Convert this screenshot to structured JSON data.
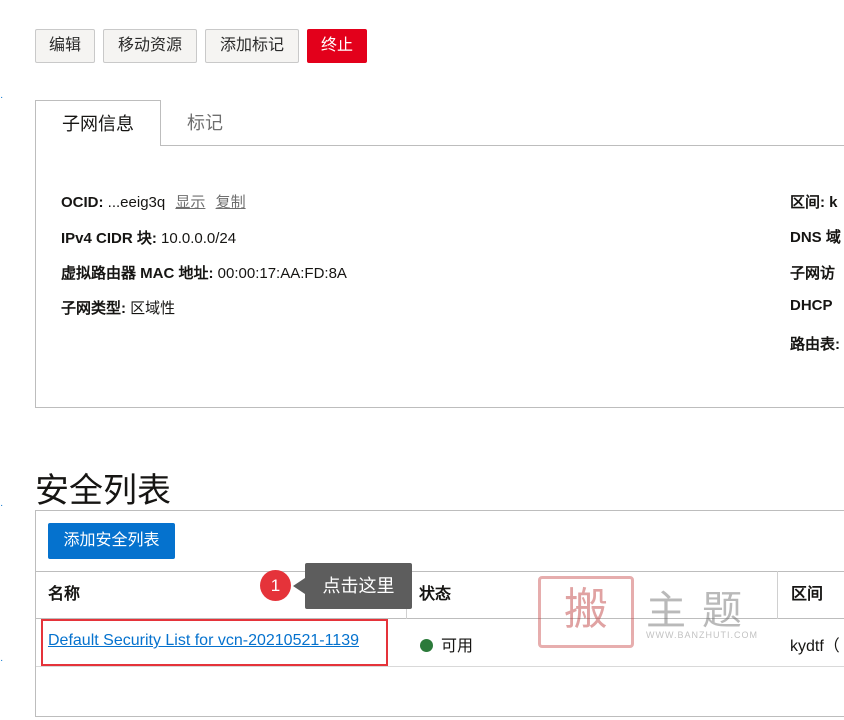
{
  "toolbar": {
    "edit": "编辑",
    "move": "移动资源",
    "add_tags": "添加标记",
    "terminate": "终止"
  },
  "tabs": [
    {
      "label": "子网信息",
      "active": true
    },
    {
      "label": "标记",
      "active": false
    }
  ],
  "details": {
    "ocid_label": "OCID:",
    "ocid_value": "...eeig3q",
    "ocid_show": "显示",
    "ocid_copy": "复制",
    "cidr_label": "IPv4 CIDR 块:",
    "cidr_value": "10.0.0.0/24",
    "mac_label": "虚拟路由器 MAC 地址:",
    "mac_value": "00:00:17:AA:FD:8A",
    "type_label": "子网类型:",
    "type_value": "区域性",
    "right_col": [
      "区间: k",
      "DNS 域",
      "子网访",
      "DHCP",
      "路由表:"
    ]
  },
  "security_lists": {
    "title": "安全列表",
    "add_button": "添加安全列表",
    "columns": [
      "名称",
      "状态",
      "区间"
    ],
    "rows": [
      {
        "name": "Default Security List for vcn-20210521-1139",
        "status": "可用",
        "compartment": "kydtf（"
      }
    ]
  },
  "annotation": {
    "step": "1",
    "tooltip": "点击这里"
  },
  "watermark": {
    "seal": "搬",
    "text": "主题",
    "url": "WWW.BANZHUTI.COM"
  },
  "colors": {
    "danger": "#e3001b",
    "primary": "#0572ce",
    "status_ok": "#2b7a3a",
    "highlight": "#e5333a"
  }
}
